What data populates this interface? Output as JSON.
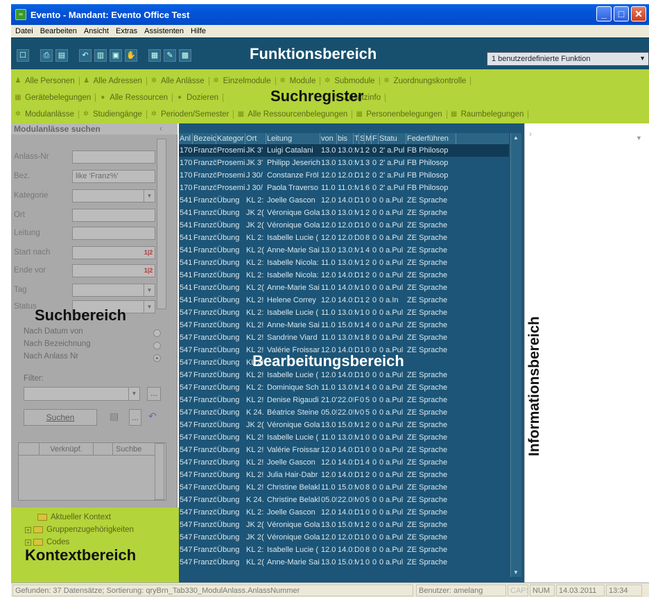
{
  "window": {
    "title": "Evento - Mandant: Evento Office Test"
  },
  "menu": [
    "Datei",
    "Bearbeiten",
    "Ansicht",
    "Extras",
    "Assistenten",
    "Hilfe"
  ],
  "overlay_labels": {
    "funktion": "Funktionsbereich",
    "suchregister": "Suchregister",
    "suchbereich": "Suchbereich",
    "bearbeitung": "Bearbeitungsbereich",
    "information": "Informationsbereich",
    "kontext": "Kontextbereich"
  },
  "function_bar": {
    "select_value": "1 benutzerdefinierte Funktion"
  },
  "search_tabs": {
    "row1": [
      "Alle Personen",
      "Alle Adressen",
      "Alle Anlässe",
      "Einzelmodule",
      "Module",
      "Submodule",
      "Zuordnungskontrolle"
    ],
    "row2": [
      "Gerätebelegungen",
      "Alle Ressourcen",
      "Dozieren",
      "",
      "Zusatzinfo"
    ],
    "row3": [
      "Modulanlässe",
      "Studiengänge",
      "Perioden/Semester",
      "Alle Ressourcenbelegungen",
      "Personenbelegungen",
      "Raumbelegungen"
    ]
  },
  "search_panel": {
    "header": "Modulanlässe suchen",
    "fields": [
      {
        "label": "Anlass-Nr",
        "value": ""
      },
      {
        "label": "Bez.",
        "value": "like 'Franz%'"
      },
      {
        "label": "Kategorie",
        "value": ""
      },
      {
        "label": "Ort",
        "value": ""
      },
      {
        "label": "Leitung",
        "value": ""
      },
      {
        "label": "Start nach",
        "value": ""
      },
      {
        "label": "Ende vor",
        "value": ""
      },
      {
        "label": "Tag",
        "value": ""
      },
      {
        "label": "Status",
        "value": ""
      }
    ],
    "sort_options": [
      "Nach Datum von",
      "Nach Bezeichnung",
      "Nach Anlass Nr"
    ],
    "selected_sort": "Nach Anlass Nr",
    "filter_label": "Filter:",
    "search_button": "Suchen",
    "link_columns": [
      "",
      "Verknüpf.",
      "Suchbe"
    ]
  },
  "context_panel": {
    "items": [
      "Aktueller Kontext",
      "Gruppenzugehörigkeiten",
      "Codes"
    ]
  },
  "grid": {
    "columns": [
      "Anl",
      "Bezeichn",
      "Kategor",
      "Ort",
      "Leitung",
      "von",
      "bis",
      "T",
      "S",
      "M",
      "F",
      "Statu",
      "Federführen"
    ],
    "rows": [
      [
        "170",
        "Französis",
        "Proseminar",
        "JK 3'",
        "Luigi Catalani",
        "13.0",
        "13.0:",
        "M",
        "1",
        "2",
        "0",
        "2' a.Pul",
        "FB Philosop"
      ],
      [
        "170",
        "Französis",
        "Proseminar",
        "JK 3'",
        "Philipp Jeserich",
        "13.0",
        "13.0:",
        "M",
        "1",
        "3",
        "0",
        "2' a.Pul",
        "FB Philosop"
      ],
      [
        "170",
        "Französis",
        "Proseminar",
        "J 30/",
        "Constanze Fröl",
        "12.0",
        "12.0:",
        "D",
        "1",
        "2",
        "0",
        "2' a.Pul",
        "FB Philosop"
      ],
      [
        "170",
        "Französis",
        "Proseminar",
        "J 30/",
        "Paola Traverso",
        "11.0",
        "11.0:",
        "M",
        "1",
        "6",
        "0",
        "2' a.Pul",
        "FB Philosop"
      ],
      [
        "541",
        "Französis",
        "Übung",
        "KL 2:",
        "Joelle Gascon",
        "12.0",
        "14.0:",
        "D",
        "1",
        "0",
        "0",
        "0 a.Pul",
        "ZE Sprache"
      ],
      [
        "541",
        "Französis",
        "Übung",
        "JK 2(",
        "Véronique Gola",
        "13.0",
        "13.0:",
        "M",
        "1",
        "2",
        "0",
        "0 a.Pul",
        "ZE Sprache"
      ],
      [
        "541",
        "Französis",
        "Übung",
        "JK 2(",
        "Véronique Gola",
        "12.0",
        "12.0:",
        "D",
        "1",
        "0",
        "0",
        "0 a.Pul",
        "ZE Sprache"
      ],
      [
        "541",
        "Französis",
        "Übung",
        "KL 2:",
        "Isabelle Lucie (",
        "12.0",
        "12.0:",
        "D",
        "0",
        "8",
        "0",
        "0 a.Pul",
        "ZE Sprache"
      ],
      [
        "541",
        "Französis",
        "Übung",
        "KL 2(",
        "Anne-Marie Sai",
        "13.0",
        "13.0:",
        "M",
        "1",
        "4",
        "0",
        "0 a.Pul",
        "ZE Sprache"
      ],
      [
        "541",
        "Französis",
        "Übung",
        "KL 2:",
        "Isabelle Nicola:",
        "11.0",
        "13.0:",
        "M",
        "1",
        "2",
        "0",
        "0 a.Pul",
        "ZE Sprache"
      ],
      [
        "541",
        "Französis",
        "Übung",
        "KL 2:",
        "Isabelle Nicola:",
        "12.0",
        "14.0:",
        "D",
        "1",
        "2",
        "0",
        "0 a.Pul",
        "ZE Sprache"
      ],
      [
        "541",
        "Französis",
        "Übung",
        "KL 2(",
        "Anne-Marie Sai",
        "11.0",
        "14.0:",
        "M",
        "1",
        "0",
        "0",
        "0 a.Pul",
        "ZE Sprache"
      ],
      [
        "541",
        "Französis",
        "Übung",
        "KL 2!",
        "Helene Correy",
        "12.0",
        "14.0:",
        "D",
        "1",
        "2",
        "0",
        "0 a.In",
        "ZE Sprache"
      ],
      [
        "547",
        "Französis",
        "Übung",
        "KL 2:",
        "Isabelle Lucie (",
        "11.0",
        "13.0:",
        "M",
        "1",
        "0",
        "0",
        "0 a.Pul",
        "ZE Sprache"
      ],
      [
        "547",
        "Französis",
        "Übung",
        "KL 2!",
        "Anne-Marie Sai",
        "11.0",
        "15.0:",
        "M",
        "1",
        "4",
        "0",
        "0 a.Pul",
        "ZE Sprache"
      ],
      [
        "547",
        "Französis",
        "Übung",
        "KL 2!",
        "Sandrine Viard",
        "11.0",
        "13.0:",
        "M",
        "1",
        "8",
        "0",
        "0 a.Pul",
        "ZE Sprache"
      ],
      [
        "547",
        "Französis",
        "Übung",
        "KL 2!",
        "Valérie Froissar",
        "12.0",
        "14.0:",
        "D",
        "1",
        "0",
        "0",
        "0 a.Pul",
        "ZE Sprache"
      ],
      [
        "547",
        "Französis",
        "Übung",
        "KL 2!",
        "",
        "",
        "",
        "",
        "",
        "",
        "",
        "",
        ""
      ],
      [
        "547",
        "Französis",
        "Übung",
        "KL 2!",
        "Isabelle Lucie (",
        "12.0",
        "14.0:",
        "D",
        "1",
        "0",
        "0",
        "0 a.Pul",
        "ZE Sprache"
      ],
      [
        "547",
        "Französis",
        "Übung",
        "KL 2:",
        "Dominique Sch",
        "11.0",
        "13.0:",
        "M",
        "1",
        "4",
        "0",
        "0 a.Pul",
        "ZE Sprache"
      ],
      [
        "547",
        "Französis",
        "Übung",
        "KL 2!",
        "Denise Rigaudi",
        "21.0'",
        "22.0!",
        "Fr",
        "0",
        "5",
        "0",
        "0 a.Pul",
        "ZE Sprache"
      ],
      [
        "547",
        "Französis",
        "Übung",
        "K 24.",
        "Béatrice Steine",
        "05.0!",
        "22.0!",
        "M",
        "0",
        "5",
        "0",
        "0 a.Pul",
        "ZE Sprache"
      ],
      [
        "547",
        "Französis",
        "Übung",
        "JK 2(",
        "Véronique Gola",
        "13.0",
        "15.0:",
        "M",
        "1",
        "2",
        "0",
        "0 a.Pul",
        "ZE Sprache"
      ],
      [
        "547",
        "Französis",
        "Übung",
        "KL 2!",
        "Isabelle Lucie (",
        "11.0",
        "13.0:",
        "M",
        "1",
        "0",
        "0",
        "0 a.Pul",
        "ZE Sprache"
      ],
      [
        "547",
        "Französis",
        "Übung",
        "KL 2!",
        "Valérie Froissar",
        "12.0",
        "14.0:",
        "D",
        "1",
        "0",
        "0",
        "0 a.Pul",
        "ZE Sprache"
      ],
      [
        "547",
        "Französis",
        "Übung",
        "KL 2!",
        "Joelle Gascon",
        "12.0",
        "14.0:",
        "D",
        "1",
        "4",
        "0",
        "0 a.Pul",
        "ZE Sprache"
      ],
      [
        "547",
        "Französis",
        "Übung",
        "KL 2!",
        "Julia Hair-Dabr",
        "12.0",
        "14.0:",
        "D",
        "1",
        "2",
        "0",
        "0 a.Pul",
        "ZE Sprache"
      ],
      [
        "547",
        "Französis",
        "Übung",
        "KL 2!",
        "Christine Belakl",
        "11.0",
        "15.0:",
        "M",
        "0",
        "8",
        "0",
        "0 a.Pul",
        "ZE Sprache"
      ],
      [
        "547",
        "Französis",
        "Übung",
        "K 24.",
        "Christine Belakl",
        "05.0!",
        "22.0!",
        "M",
        "0",
        "5",
        "0",
        "0 a.Pul",
        "ZE Sprache"
      ],
      [
        "547",
        "Französis",
        "Übung",
        "KL 2:",
        "Joelle Gascon",
        "12.0",
        "14.0:",
        "D",
        "1",
        "0",
        "0",
        "0 a.Pul",
        "ZE Sprache"
      ],
      [
        "547",
        "Französis",
        "Übung",
        "JK 2(",
        "Véronique Gola",
        "13.0",
        "15.0:",
        "M",
        "1",
        "2",
        "0",
        "0 a.Pul",
        "ZE Sprache"
      ],
      [
        "547",
        "Französis",
        "Übung",
        "JK 2(",
        "Véronique Gola",
        "12.0",
        "12.0:",
        "D",
        "1",
        "0",
        "0",
        "0 a.Pul",
        "ZE Sprache"
      ],
      [
        "547",
        "Französis",
        "Übung",
        "KL 2:",
        "Isabelle Lucie (",
        "12.0",
        "14.0:",
        "D",
        "0",
        "8",
        "0",
        "0 a.Pul",
        "ZE Sprache"
      ],
      [
        "547",
        "Französis",
        "Übung",
        "KL 2(",
        "Anne-Marie Sai",
        "13.0",
        "15.0:",
        "M",
        "1",
        "0",
        "0",
        "0 a.Pul",
        "ZE Sprache"
      ]
    ]
  },
  "status": {
    "found": "Gefunden: 37 Datensätze; Sortierung: qryBrn_Tab330_ModulAnlass.AnlassNummer",
    "user": "Benutzer: amelang",
    "caps": "CAPS",
    "num": "NUM",
    "date": "14.03.2011",
    "time": "13:34"
  },
  "colors": {
    "function_area": "#17506e",
    "register_area": "#b3d43a",
    "search_area": "#a9a9a9",
    "grid_area": "#1c5577"
  }
}
